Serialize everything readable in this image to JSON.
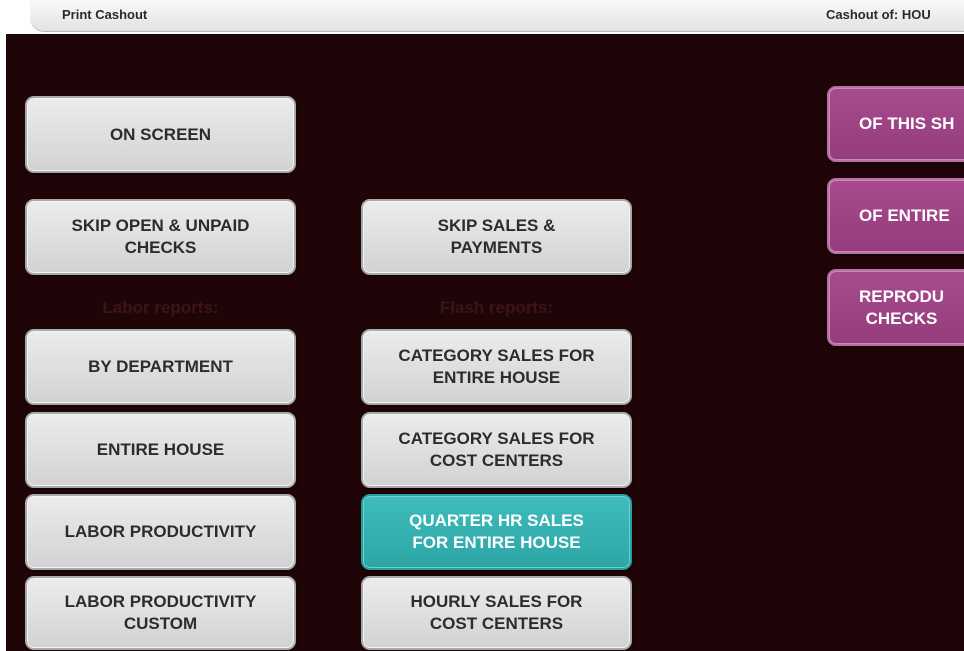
{
  "titlebar": {
    "title": "Print Cashout",
    "cashout_label": "Cashout of: HOU"
  },
  "colors": {
    "background": "#200508",
    "button_gray": "#dcdcdc",
    "button_teal": "#33aeae",
    "button_magenta": "#9e4486"
  },
  "left_column": {
    "on_screen": "ON SCREEN",
    "skip_open_unpaid": "SKIP OPEN & UNPAID\nCHECKS",
    "labor_section_label": "Labor reports:",
    "by_department": "BY DEPARTMENT",
    "entire_house": "ENTIRE HOUSE",
    "labor_productivity": "LABOR PRODUCTIVITY",
    "labor_productivity_custom": "LABOR PRODUCTIVITY\nCUSTOM"
  },
  "middle_column": {
    "skip_sales_payments": "SKIP SALES &\nPAYMENTS",
    "flash_section_label": "Flash reports:",
    "category_sales_entire_house": "CATEGORY SALES FOR\nENTIRE HOUSE",
    "category_sales_cost_centers": "CATEGORY SALES FOR\nCOST CENTERS",
    "quarter_hr_sales": "QUARTER HR SALES\nFOR ENTIRE HOUSE",
    "hourly_sales_cost_centers": "HOURLY SALES FOR\nCOST CENTERS"
  },
  "right_column": {
    "of_this_shift": "OF THIS SH",
    "of_entire": "OF ENTIRE",
    "reproduce_checks": "REPRODU\nCHECKS"
  }
}
